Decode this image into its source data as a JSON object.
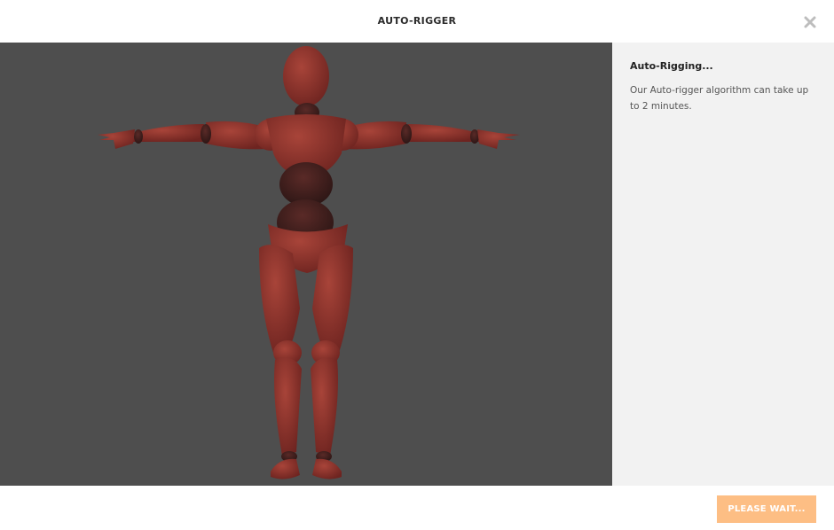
{
  "dialog": {
    "title": "AUTO-RIGGER"
  },
  "viewport": {
    "model_color": "#8f332d",
    "background_color": "#4e4e4e"
  },
  "side_panel": {
    "title": "Auto-Rigging...",
    "message": "Our Auto-rigger algorithm can take up to 2 minutes."
  },
  "footer": {
    "wait_button_label": "PLEASE WAIT...",
    "wait_button_color": "#fdbe84"
  }
}
